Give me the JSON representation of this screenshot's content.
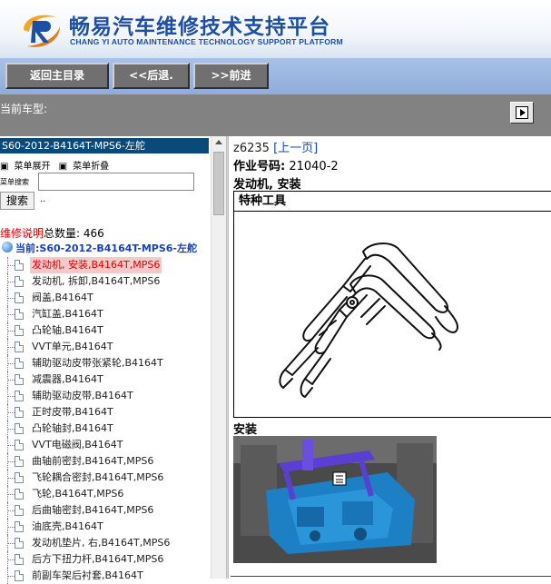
{
  "header": {
    "brand_cn": "畅易汽车维修技术支持平台",
    "brand_en": "CHANG YI AUTO MAINTENANCE TECHNOLOGY SUPPORT PLATFORM",
    "logo_letter": "R"
  },
  "toolbar": {
    "home": "返回主目录",
    "back": "<<后退.",
    "forward": ">>前进"
  },
  "vehicle": {
    "label": "当前车型:"
  },
  "sidebar": {
    "title": "S60-2012-B4164T-MPS6-左舵",
    "expand": "菜单展开",
    "collapse": "菜单折叠",
    "search_label": "菜单搜索",
    "search_button": "搜索",
    "dots": "..",
    "count_label": "维修说明",
    "count_text": "总数量: 466",
    "current": "当前:S60-2012-B4164T-MPS6-左舵",
    "items": [
      "发动机, 安装,B4164T,MPS6",
      "发动机, 拆卸,B4164T,MPS6",
      "阀盖,B4164T",
      "汽缸盖,B4164T",
      "凸轮轴,B4164T",
      "VVT单元,B4164T",
      "辅助驱动皮带张紧轮,B4164T",
      "减震器,B4164T",
      "辅助驱动皮带,B4164T",
      "正时皮带,B4164T",
      "凸轮轴封,B4164T",
      "VVT电磁阀,B4164T",
      "曲轴前密封,B4164T,MPS6",
      "飞轮耦合密封,B4164T,MPS6",
      "飞轮,B4164T,MPS6",
      "后曲轴密封,B4164T,MPS6",
      "油底壳,B4164T",
      "发动机垫片, 右,B4164T,MPS6",
      "后方下扭力杆,B4164T,MPS6",
      "前副车架后衬套,B4164T"
    ]
  },
  "content": {
    "code": "z6235",
    "prev_link": "[上一页]",
    "job_label": "作业号码:",
    "job_number": "21040-2",
    "title": "发动机, 安装",
    "tool_heading": "特种工具",
    "install_heading": "安装"
  },
  "colors": {
    "accent": "#1d4fa5",
    "toolbar": "#9cb8e2",
    "sidebar_title": "#0a4a7a",
    "active": "#dd0000"
  }
}
